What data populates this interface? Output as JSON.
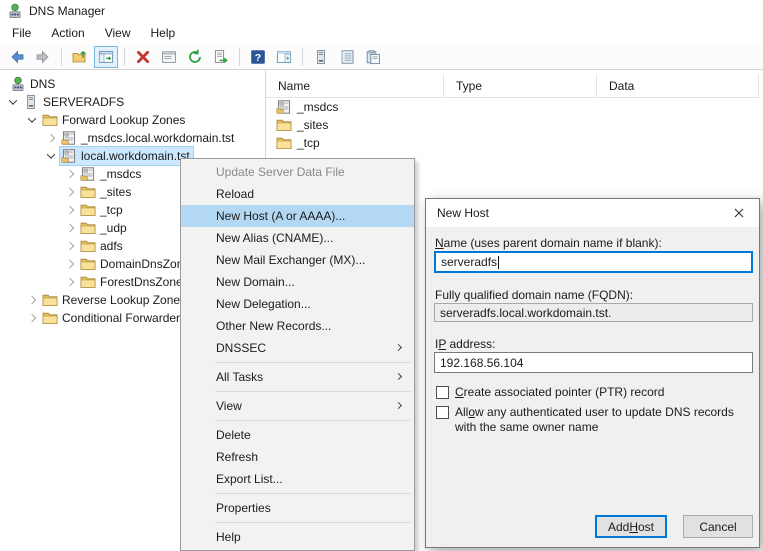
{
  "window": {
    "title": "DNS Manager"
  },
  "menu": {
    "items": [
      "File",
      "Action",
      "View",
      "Help"
    ]
  },
  "toolbar": {
    "icons": [
      "back",
      "forward",
      "up-one-level",
      "show-hide-console-tree",
      "delete",
      "properties",
      "refresh",
      "export-list",
      "help",
      "show-hide-action-pane",
      "server",
      "record-list",
      "clipboard"
    ]
  },
  "tree": {
    "items": [
      {
        "label": "DNS",
        "level": 0,
        "expander": "none",
        "icon": "dns-root"
      },
      {
        "label": "SERVERADFS",
        "level": 1,
        "expander": "expanded",
        "icon": "server"
      },
      {
        "label": "Forward Lookup Zones",
        "level": 2,
        "expander": "expanded",
        "icon": "folder"
      },
      {
        "label": "_msdcs.local.workdomain.tst",
        "level": 3,
        "expander": "collapsed",
        "icon": "zone"
      },
      {
        "label": "local.workdomain.tst",
        "level": 3,
        "expander": "expanded",
        "icon": "zone",
        "selected": true
      },
      {
        "label": "_msdcs",
        "level": 4,
        "expander": "collapsed",
        "icon": "zone"
      },
      {
        "label": "_sites",
        "level": 4,
        "expander": "collapsed",
        "icon": "folder"
      },
      {
        "label": "_tcp",
        "level": 4,
        "expander": "collapsed",
        "icon": "folder"
      },
      {
        "label": "_udp",
        "level": 4,
        "expander": "collapsed",
        "icon": "folder"
      },
      {
        "label": "adfs",
        "level": 4,
        "expander": "collapsed",
        "icon": "folder"
      },
      {
        "label": "DomainDnsZones",
        "level": 4,
        "expander": "collapsed",
        "icon": "folder"
      },
      {
        "label": "ForestDnsZones",
        "level": 4,
        "expander": "collapsed",
        "icon": "folder"
      },
      {
        "label": "Reverse Lookup Zones",
        "level": 2,
        "expander": "collapsed",
        "icon": "folder"
      },
      {
        "label": "Conditional Forwarders",
        "level": 2,
        "expander": "collapsed",
        "icon": "folder"
      }
    ]
  },
  "list": {
    "columns": [
      "Name",
      "Type",
      "Data"
    ],
    "rows": [
      {
        "name": "_msdcs",
        "icon": "zone",
        "type": "",
        "data": ""
      },
      {
        "name": "_sites",
        "icon": "folder",
        "type": "",
        "data": ""
      },
      {
        "name": "_tcp",
        "icon": "folder",
        "type": "",
        "data": ""
      }
    ]
  },
  "context_menu": {
    "items": [
      {
        "label": "Update Server Data File",
        "disabled": true
      },
      {
        "label": "Reload"
      },
      {
        "label": "New Host (A or AAAA)...",
        "highlighted": true
      },
      {
        "label": "New Alias (CNAME)..."
      },
      {
        "label": "New Mail Exchanger (MX)..."
      },
      {
        "label": "New Domain..."
      },
      {
        "label": "New Delegation..."
      },
      {
        "label": "Other New Records..."
      },
      {
        "label": "DNSSEC",
        "submenu": true
      },
      {
        "label": "All Tasks",
        "submenu": true
      },
      {
        "label": "View",
        "submenu": true
      },
      {
        "label": "Delete"
      },
      {
        "label": "Refresh"
      },
      {
        "label": "Export List..."
      },
      {
        "label": "Properties"
      },
      {
        "label": "Help"
      }
    ]
  },
  "dialog": {
    "title": "New Host",
    "name_label": "Name (uses parent domain name if blank):",
    "name_value": "serveradfs",
    "fqdn_label": "Fully qualified domain name (FQDN):",
    "fqdn_value": "serveradfs.local.workdomain.tst.",
    "ip_label": "IP address:",
    "ip_value": "192.168.56.104",
    "ptr_checkbox_label": "Create associated pointer (PTR) record",
    "allow_checkbox_label": "Allow any authenticated user to update DNS records with the same owner name",
    "add_host_button": "Add Host",
    "cancel_button": "Cancel",
    "mnemonics": {
      "name": "N",
      "ip": "P",
      "ptr": "C",
      "allow": "o",
      "add": "H"
    }
  },
  "colors": {
    "accent": "#0078d7",
    "tree_selection": "#cce8ff",
    "menu_highlight": "#b3d8f4",
    "folder": "#f2c664"
  }
}
